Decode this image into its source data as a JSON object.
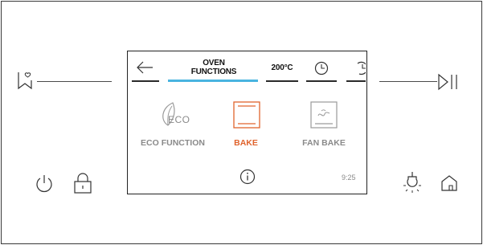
{
  "header": {
    "tab_title_line1": "OVEN",
    "tab_title_line2": "FUNCTIONS",
    "temperature": "200°C"
  },
  "functions": [
    {
      "label": "ECO FUNCTION",
      "icon": "eco-icon",
      "eco_text": "ECO",
      "active": false
    },
    {
      "label": "BAKE",
      "icon": "bake-icon",
      "active": true
    },
    {
      "label": "FAN BAKE",
      "icon": "fan-bake-icon",
      "active": false
    }
  ],
  "status": {
    "time": "9:25"
  },
  "colors": {
    "accent": "#e0632d",
    "active_tab": "#49b4e0",
    "muted": "#8a8a8a"
  }
}
